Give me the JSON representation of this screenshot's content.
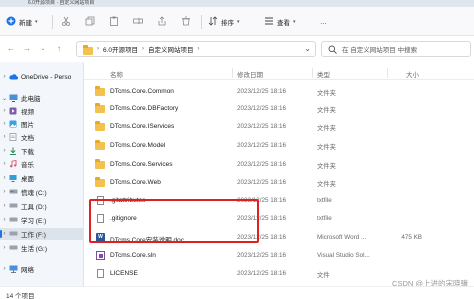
{
  "window": {
    "title_fragment": "6.0开源项目 · 自定义网站项目"
  },
  "toolbar": {
    "new_label": "新建",
    "sort_label": "排序",
    "view_label": "查看",
    "more_label": "…"
  },
  "address": {
    "crumbs": [
      "6.0开源项目",
      "自定义网站项目"
    ],
    "search_placeholder": "在 自定义网站项目 中搜索"
  },
  "sidebar": {
    "items": [
      {
        "label": "OneDrive - Perso",
        "icon": "cloud-icon",
        "expander": "›"
      },
      {
        "label": "此电脑",
        "icon": "pc-icon",
        "expander": "⌄"
      },
      {
        "label": "视频",
        "icon": "video-icon",
        "expander": "›"
      },
      {
        "label": "图片",
        "icon": "picture-icon",
        "expander": "›"
      },
      {
        "label": "文档",
        "icon": "document-icon",
        "expander": "›"
      },
      {
        "label": "下载",
        "icon": "download-icon",
        "expander": "›"
      },
      {
        "label": "音乐",
        "icon": "music-icon",
        "expander": "›"
      },
      {
        "label": "桌面",
        "icon": "desktop-icon",
        "expander": "›"
      },
      {
        "label": "慌魂 (C:)",
        "icon": "drive-icon",
        "expander": "›"
      },
      {
        "label": "工具 (D:)",
        "icon": "drive-icon",
        "expander": "›"
      },
      {
        "label": "学习 (E:)",
        "icon": "drive-icon",
        "expander": "›"
      },
      {
        "label": "工作 (F:)",
        "icon": "drive-icon",
        "expander": "›"
      },
      {
        "label": "生活 (G:)",
        "icon": "drive-icon",
        "expander": "›"
      },
      {
        "label": "网络",
        "icon": "network-icon",
        "expander": "›"
      }
    ]
  },
  "columns": {
    "name": "名称",
    "date": "修改日期",
    "type": "类型",
    "size": "大小"
  },
  "files": [
    {
      "name": "DTcms.Core.Common",
      "date": "2023/12/25 18:16",
      "type": "文件夹",
      "size": "",
      "kind": "folder"
    },
    {
      "name": "DTcms.Core.DBFactory",
      "date": "2023/12/25 18:16",
      "type": "文件夹",
      "size": "",
      "kind": "folder"
    },
    {
      "name": "DTcms.Core.IServices",
      "date": "2023/12/25 18:16",
      "type": "文件夹",
      "size": "",
      "kind": "folder"
    },
    {
      "name": "DTcms.Core.Model",
      "date": "2023/12/25 18:16",
      "type": "文件夹",
      "size": "",
      "kind": "folder"
    },
    {
      "name": "DTcms.Core.Services",
      "date": "2023/12/25 18:16",
      "type": "文件夹",
      "size": "",
      "kind": "folder"
    },
    {
      "name": "DTcms.Core.Web",
      "date": "2023/12/25 18:16",
      "type": "文件夹",
      "size": "",
      "kind": "folder"
    },
    {
      "name": ".gitattributes",
      "date": "2023/12/25 18:16",
      "type": "txtfile",
      "size": "",
      "kind": "text"
    },
    {
      "name": ".gitignore",
      "date": "2023/12/25 18:16",
      "type": "txtfile",
      "size": "",
      "kind": "text"
    },
    {
      "name": "DTcms.Core安装说明.doc",
      "date": "2023/12/25 18:16",
      "type": "Microsoft Word ...",
      "size": "475 KB",
      "kind": "word"
    },
    {
      "name": "DTcms.Core.sln",
      "date": "2023/12/25 18:16",
      "type": "Visual Studio Sol...",
      "size": "",
      "kind": "sln"
    },
    {
      "name": "LICENSE",
      "date": "2023/12/25 18:16",
      "type": "文件",
      "size": "",
      "kind": "text"
    }
  ],
  "status": {
    "item_count": "14 个项目"
  },
  "watermark": "CSDN @上进的宋晓骥",
  "colors": {
    "highlight": "#e02020",
    "folder": "#f2c14e",
    "accent": "#1a73e8"
  }
}
